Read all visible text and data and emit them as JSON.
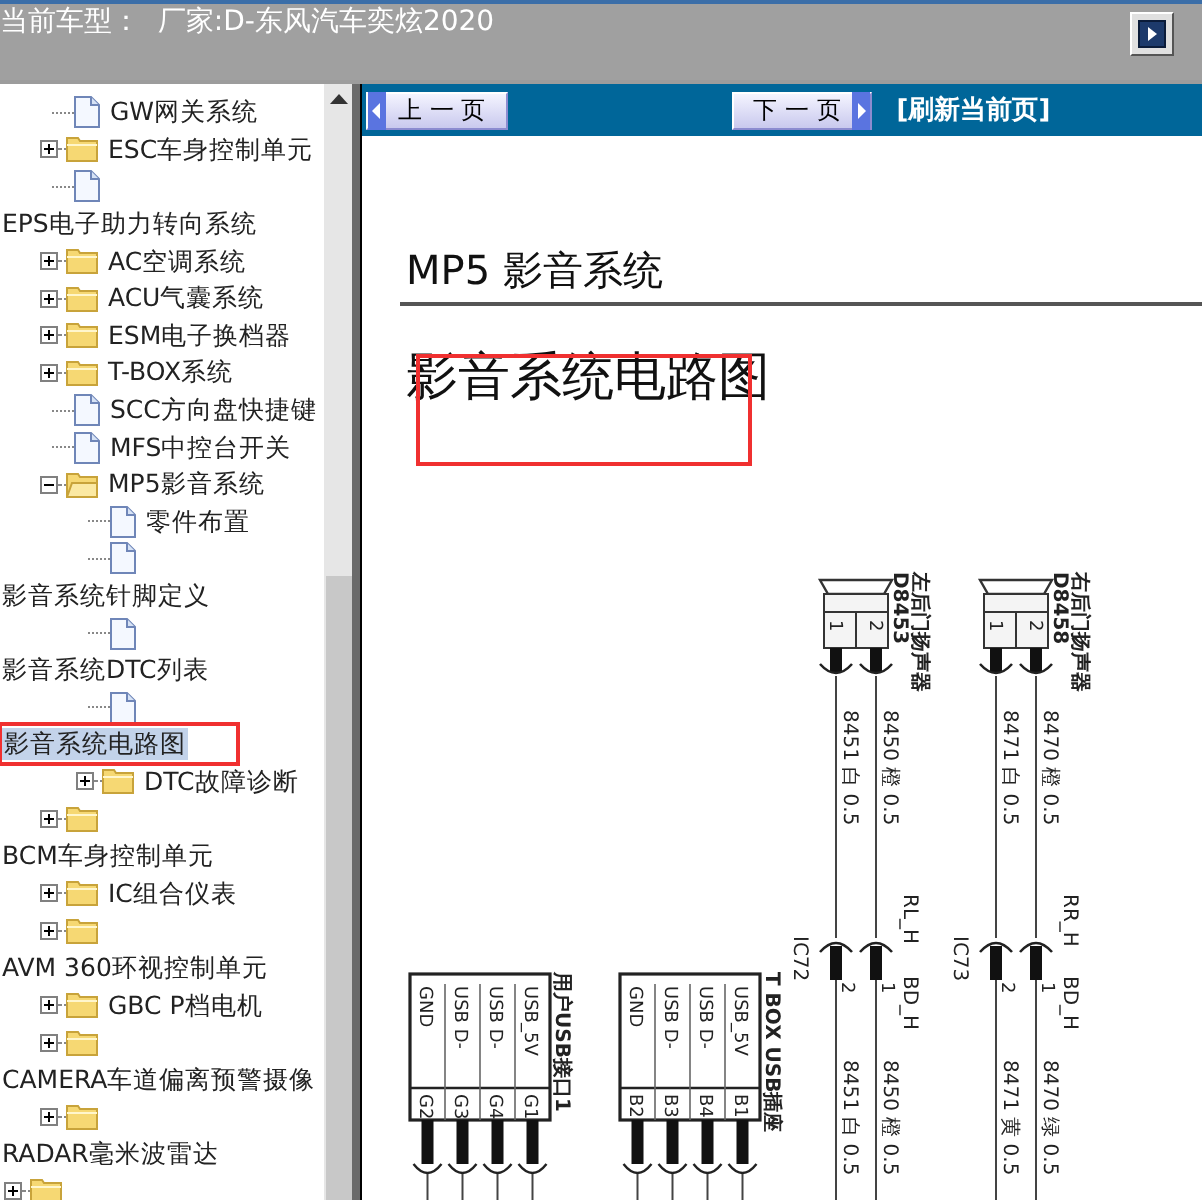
{
  "header": {
    "title": "当前车型：  厂家:D-东风汽车奕炫2020"
  },
  "tree": [
    {
      "kind": "group",
      "children": [
        {
          "kind": "doc",
          "label": "GW网关系统"
        },
        {
          "kind": "folder",
          "label": "ESC车身控制单元",
          "expanded": false
        },
        {
          "kind": "doc"
        }
      ]
    },
    {
      "kind": "heading",
      "label": "EPS电子助力转向系统",
      "selected": false,
      "children": [
        {
          "kind": "folder",
          "label": "AC空调系统",
          "expanded": false
        },
        {
          "kind": "folder",
          "label": "ACU气囊系统",
          "expanded": false
        },
        {
          "kind": "folder",
          "label": "ESM电子换档器",
          "expanded": false
        },
        {
          "kind": "folder",
          "label": "T-BOX系统",
          "expanded": false
        },
        {
          "kind": "doc",
          "label": "SCC方向盘快捷键"
        },
        {
          "kind": "doc",
          "label": "MFS中控台开关"
        },
        {
          "kind": "folder",
          "label": "MP5影音系统",
          "expanded": true,
          "children": [
            {
              "kind": "doc",
              "label": "零件布置"
            },
            {
              "kind": "doc"
            }
          ]
        }
      ]
    },
    {
      "kind": "heading",
      "label": "影音系统针脚定义",
      "selected": false,
      "children": [
        {
          "kind": "group",
          "children": [
            {
              "kind": "doc"
            }
          ]
        }
      ]
    },
    {
      "kind": "heading",
      "label": "影音系统DTC列表",
      "selected": false,
      "children": [
        {
          "kind": "group",
          "children": [
            {
              "kind": "doc"
            }
          ]
        }
      ]
    },
    {
      "kind": "heading",
      "label": "影音系统电路图",
      "selected": true,
      "annotated": true,
      "children": [
        {
          "kind": "group",
          "children": [
            {
              "kind": "folder",
              "label": "DTC故障诊断",
              "expanded": false
            }
          ]
        },
        {
          "kind": "folder",
          "expanded": false
        }
      ]
    },
    {
      "kind": "heading",
      "label": "BCM车身控制单元",
      "selected": false,
      "children": [
        {
          "kind": "folder",
          "label": "IC组合仪表",
          "expanded": false
        },
        {
          "kind": "folder",
          "expanded": false
        }
      ]
    },
    {
      "kind": "heading",
      "label": "AVM 360环视控制单元",
      "selected": false,
      "children": [
        {
          "kind": "folder",
          "label": "GBC P档电机",
          "expanded": false
        },
        {
          "kind": "folder",
          "expanded": false
        }
      ]
    },
    {
      "kind": "heading",
      "label": "CAMERA车道偏离预警摄像",
      "selected": false,
      "children": [
        {
          "kind": "folder",
          "expanded": false
        }
      ]
    },
    {
      "kind": "heading",
      "label": "RADAR毫米波雷达",
      "selected": false
    },
    {
      "kind": "folder",
      "expanded": false
    }
  ],
  "toolbar": {
    "buttons": [
      {
        "kind": "prev",
        "label": "上 一 页"
      },
      {
        "kind": "next",
        "label": "下 一 页"
      }
    ],
    "link": "[刷新当前页]"
  },
  "document": {
    "section_title": "MP5 影音系统",
    "page_title": "影音系统电路图",
    "page_title_annotated": true,
    "diagram": {
      "speakers": [
        {
          "name": "左后门扬声器",
          "code": "D8453",
          "pins": [
            {
              "pin": "1",
              "label": "8451 白 0.5"
            },
            {
              "pin": "2",
              "label": "8450 橙 0.5"
            }
          ],
          "signals": [
            "RL_H",
            "BD_H"
          ],
          "inline_code": "IC72",
          "inline_pins": [
            {
              "pin": "2",
              "label": "8451 白 0.5"
            },
            {
              "pin": "1",
              "label": "8450 橙 0.5"
            }
          ]
        },
        {
          "name": "右后门扬声器",
          "code": "D8458",
          "pins": [
            {
              "pin": "1",
              "label": "8471 白 0.5"
            },
            {
              "pin": "2",
              "label": "8470 橙 0.5"
            }
          ],
          "signals": [
            "RR_H",
            "BD_H"
          ],
          "inline_code": "IC73",
          "inline_pins": [
            {
              "pin": "2",
              "label": "8471 黄 0.5"
            },
            {
              "pin": "1",
              "label": "8470 绿 0.5"
            }
          ]
        }
      ],
      "usb_connectors": [
        {
          "name": "用户USB接口1",
          "pins": [
            {
              "name": "GND",
              "code": "G2"
            },
            {
              "name": "USB D-",
              "code": "G3"
            },
            {
              "name": "USB D-",
              "code": "G4"
            },
            {
              "name": "USB_5V",
              "code": "G1"
            }
          ]
        },
        {
          "name": "T BOX USB插座",
          "pins": [
            {
              "name": "GND",
              "code": "B2"
            },
            {
              "name": "USB D-",
              "code": "B3"
            },
            {
              "name": "USB D-",
              "code": "B4"
            },
            {
              "name": "USB_5V",
              "code": "B1"
            }
          ]
        }
      ]
    }
  }
}
